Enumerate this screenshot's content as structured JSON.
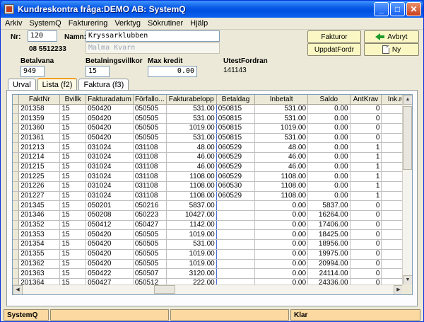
{
  "window": {
    "title": "Kundreskontra fråga:DEMO AB: SystemQ"
  },
  "titlebar_buttons": {
    "minimize": "_",
    "maximize": "□",
    "close": "✕"
  },
  "menu": [
    "Arkiv",
    "SystemQ",
    "Fakturering",
    "Verktyg",
    "Sökrutiner",
    "Hjälp"
  ],
  "customer": {
    "nr_label": "Nr:",
    "nr_value": "120",
    "phone": "08 5512233",
    "namn_label": "Namn:",
    "namn_value": "Kryssarklubben",
    "namn_second": "Malma Kvarn"
  },
  "buttons": {
    "fakturor": "Fakturor",
    "avbryt": "Avbryt",
    "uppdatfordr": "UppdatFordr",
    "ny": "Ny"
  },
  "info": {
    "betalvana_label": "Betalvana",
    "betalvana_value": "949",
    "betalningsvillkor_label": "Betalningsvillkor",
    "betalningsvillkor_value": "15",
    "max_kredit_label": "Max kredit",
    "max_kredit_value": "0.00",
    "utestfordran_label": "UtestFordran",
    "utestfordran_value": "141143"
  },
  "tabs": [
    "Urval",
    "Lista (f2)",
    "Faktura (f3)"
  ],
  "table": {
    "columns": [
      "FaktNr",
      "Bvillk",
      "Fakturadatum",
      "Förfallo...",
      "Fakturabelopp",
      "Betaldag",
      "Inbetalt",
      "Saldo",
      "AntKrav",
      "Ink.re"
    ],
    "rows": [
      [
        "201358",
        "15",
        "050420",
        "050505",
        "531.00",
        "050815",
        "531.00",
        "0.00",
        "0",
        ""
      ],
      [
        "201359",
        "15",
        "050420",
        "050505",
        "531.00",
        "050815",
        "531.00",
        "0.00",
        "0",
        ""
      ],
      [
        "201360",
        "15",
        "050420",
        "050505",
        "1019.00",
        "050815",
        "1019.00",
        "0.00",
        "0",
        ""
      ],
      [
        "201361",
        "15",
        "050420",
        "050505",
        "531.00",
        "050815",
        "531.00",
        "0.00",
        "0",
        ""
      ],
      [
        "201213",
        "15",
        "031024",
        "031108",
        "48.00",
        "060529",
        "48.00",
        "0.00",
        "1",
        ""
      ],
      [
        "201214",
        "15",
        "031024",
        "031108",
        "46.00",
        "060529",
        "46.00",
        "0.00",
        "1",
        ""
      ],
      [
        "201215",
        "15",
        "031024",
        "031108",
        "46.00",
        "060529",
        "46.00",
        "0.00",
        "1",
        ""
      ],
      [
        "201225",
        "15",
        "031024",
        "031108",
        "1108.00",
        "060529",
        "1108.00",
        "0.00",
        "1",
        ""
      ],
      [
        "201226",
        "15",
        "031024",
        "031108",
        "1108.00",
        "060530",
        "1108.00",
        "0.00",
        "1",
        ""
      ],
      [
        "201227",
        "15",
        "031024",
        "031108",
        "1108.00",
        "060529",
        "1108.00",
        "0.00",
        "1",
        ""
      ],
      [
        "201345",
        "15",
        "050201",
        "050216",
        "5837.00",
        "",
        "0.00",
        "5837.00",
        "0",
        ""
      ],
      [
        "201346",
        "15",
        "050208",
        "050223",
        "10427.00",
        "",
        "0.00",
        "16264.00",
        "0",
        ""
      ],
      [
        "201352",
        "15",
        "050412",
        "050427",
        "1142.00",
        "",
        "0.00",
        "17406.00",
        "0",
        ""
      ],
      [
        "201353",
        "15",
        "050420",
        "050505",
        "1019.00",
        "",
        "0.00",
        "18425.00",
        "0",
        ""
      ],
      [
        "201354",
        "15",
        "050420",
        "050505",
        "531.00",
        "",
        "0.00",
        "18956.00",
        "0",
        ""
      ],
      [
        "201355",
        "15",
        "050420",
        "050505",
        "1019.00",
        "",
        "0.00",
        "19975.00",
        "0",
        ""
      ],
      [
        "201362",
        "15",
        "050420",
        "050505",
        "1019.00",
        "",
        "0.00",
        "20994.00",
        "0",
        ""
      ],
      [
        "201363",
        "15",
        "050422",
        "050507",
        "3120.00",
        "",
        "0.00",
        "24114.00",
        "0",
        ""
      ],
      [
        "201364",
        "15",
        "050427",
        "050512",
        "222.00",
        "",
        "0.00",
        "24336.00",
        "0",
        ""
      ]
    ]
  },
  "statusbar": {
    "left": "SystemQ",
    "right": "Klar"
  }
}
